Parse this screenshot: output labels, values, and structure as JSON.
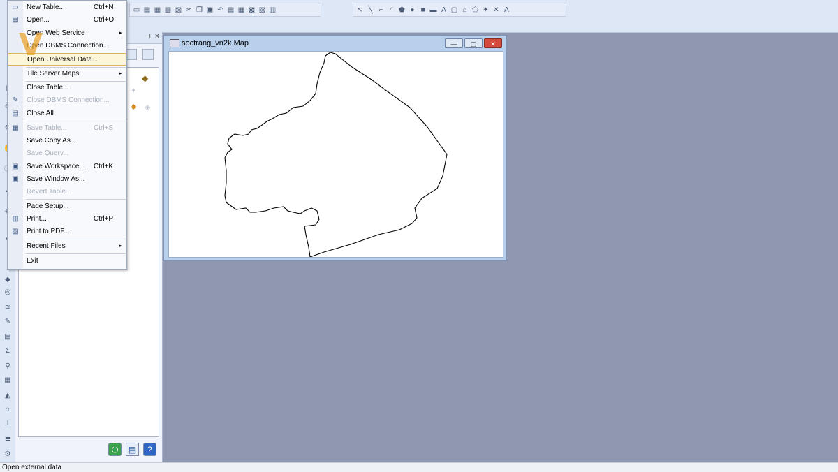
{
  "file_menu": {
    "items": [
      {
        "label": "New Table...",
        "shortcut": "Ctrl+N"
      },
      {
        "label": "Open...",
        "shortcut": "Ctrl+O"
      },
      {
        "label": "Open Web Service"
      },
      {
        "label": "Open DBMS Connection..."
      },
      {
        "label": "Open Universal Data..."
      },
      {
        "label": "Tile Server Maps"
      },
      {
        "label": "Close Table..."
      },
      {
        "label": "Close DBMS Connection..."
      },
      {
        "label": "Close All"
      },
      {
        "label": "Save Table...",
        "shortcut": "Ctrl+S"
      },
      {
        "label": "Save Copy As..."
      },
      {
        "label": "Save Query..."
      },
      {
        "label": "Save Workspace...",
        "shortcut": "Ctrl+K"
      },
      {
        "label": "Save Window As..."
      },
      {
        "label": "Revert Table..."
      },
      {
        "label": "Page Setup..."
      },
      {
        "label": "Print...",
        "shortcut": "Ctrl+P"
      },
      {
        "label": "Print to PDF..."
      },
      {
        "label": "Recent Files"
      },
      {
        "label": "Exit"
      }
    ],
    "submenu_arrow": "▸"
  },
  "map_window": {
    "title": "soctrang_vn2k Map",
    "minimize": "—",
    "restore": "▢",
    "close": "✕"
  },
  "panel": {
    "pin": "⊣",
    "close": "×"
  },
  "status_bar": {
    "text": "Open external data"
  },
  "icons": {
    "toolbar_top": [
      "new-table-icon",
      "open-icon",
      "save-icon",
      "print-icon",
      "pdf-icon",
      "cut-icon",
      "copy-icon",
      "paste-icon",
      "undo-icon",
      "table-icon",
      "browser-icon",
      "grid-icon",
      "layout-icon",
      "legend-icon"
    ],
    "toolbar_draw": [
      "select-icon",
      "line-icon",
      "polyline-icon",
      "arc-icon",
      "polygon-icon",
      "ellipse-icon",
      "rectangle-icon",
      "rounded-rect-icon",
      "text-icon",
      "frame-icon",
      "symbol-icon",
      "reshape-icon",
      "node-icon",
      "style-icon",
      "label-icon"
    ]
  },
  "colors": {
    "workspace": "#9097b0",
    "menu_highlight": "#fdf6d8",
    "close_button": "#d44a3b"
  }
}
